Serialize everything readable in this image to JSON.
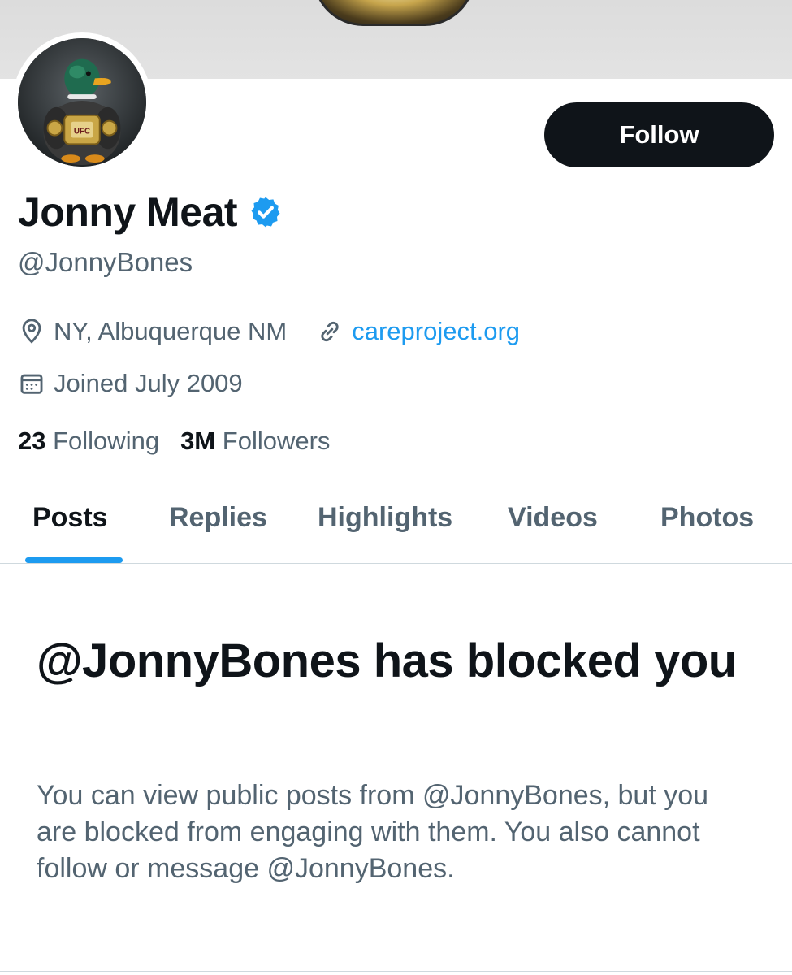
{
  "profile": {
    "display_name": "Jonny Meat",
    "handle": "@JonnyBones",
    "verified": true,
    "location": "NY, Albuquerque NM",
    "website": "careproject.org",
    "joined": "Joined July 2009"
  },
  "actions": {
    "follow_label": "Follow"
  },
  "stats": {
    "following_count": "23",
    "following_label": "Following",
    "followers_count": "3M",
    "followers_label": "Followers"
  },
  "tabs": [
    {
      "label": "Posts",
      "active": true
    },
    {
      "label": "Replies",
      "active": false
    },
    {
      "label": "Highlights",
      "active": false
    },
    {
      "label": "Videos",
      "active": false
    },
    {
      "label": "Photos",
      "active": false
    }
  ],
  "blocked": {
    "title": "@JonnyBones has blocked you",
    "description": "You can view public posts from @JonnyBones, but you are blocked from engaging with them. You also cannot follow or message @JonnyBones."
  },
  "icons": {
    "location": "location-pin-icon",
    "link": "link-icon",
    "calendar": "calendar-icon",
    "verified": "verified-badge-icon"
  },
  "colors": {
    "accent": "#1d9bf0",
    "text_primary": "#0f1419",
    "text_secondary": "#536471",
    "button_bg": "#0f1419",
    "border": "#cfd9de"
  }
}
